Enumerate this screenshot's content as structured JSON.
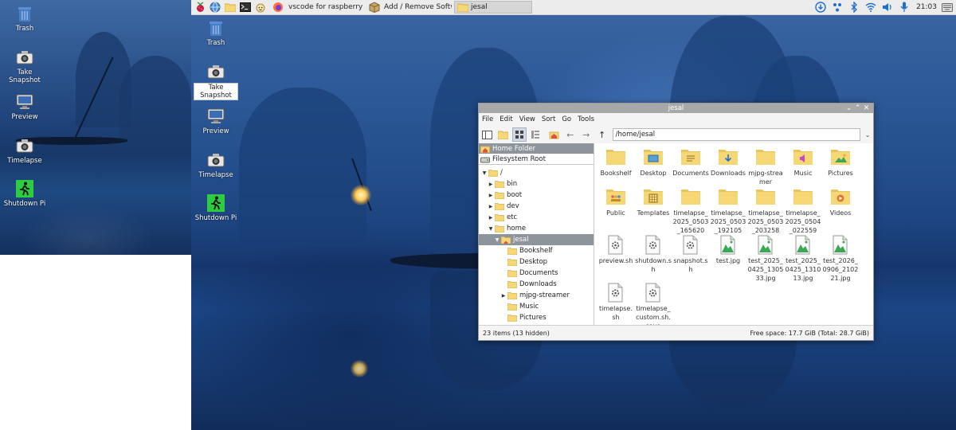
{
  "taskbar": {
    "tasks": [
      {
        "label": "vscode for raspberry ..."
      },
      {
        "label": "Add / Remove Softw..."
      },
      {
        "label": "jesal"
      }
    ],
    "clock": "21:03"
  },
  "left_desktop": {
    "icons": [
      {
        "label": "Trash"
      },
      {
        "label": "Take Snapshot"
      },
      {
        "label": "Preview"
      },
      {
        "label": "Timelapse"
      },
      {
        "label": "Shutdown Pi"
      }
    ]
  },
  "main_desktop": {
    "icons": [
      {
        "label": "Trash"
      },
      {
        "label": "Take Snapshot"
      },
      {
        "label": "Preview"
      },
      {
        "label": "Timelapse"
      },
      {
        "label": "Shutdown Pi"
      }
    ]
  },
  "file_manager": {
    "title": "jesal",
    "menu": [
      "File",
      "Edit",
      "View",
      "Sort",
      "Go",
      "Tools"
    ],
    "path": "/home/jesal",
    "places": [
      "Home Folder",
      "Filesystem Root"
    ],
    "tree": [
      {
        "label": "/"
      },
      {
        "label": "bin"
      },
      {
        "label": "boot"
      },
      {
        "label": "dev"
      },
      {
        "label": "etc"
      },
      {
        "label": "home"
      },
      {
        "label": "jesal"
      },
      {
        "label": "Bookshelf"
      },
      {
        "label": "Desktop"
      },
      {
        "label": "Documents"
      },
      {
        "label": "Downloads"
      },
      {
        "label": "mjpg-streamer"
      },
      {
        "label": "Music"
      },
      {
        "label": "Pictures"
      }
    ],
    "items": [
      {
        "label": "Bookshelf",
        "kind": "folder"
      },
      {
        "label": "Desktop",
        "kind": "folder-desktop"
      },
      {
        "label": "Documents",
        "kind": "folder-documents"
      },
      {
        "label": "Downloads",
        "kind": "folder-downloads"
      },
      {
        "label": "mjpg-streamer",
        "kind": "folder"
      },
      {
        "label": "Music",
        "kind": "folder-music"
      },
      {
        "label": "Pictures",
        "kind": "folder-pictures"
      },
      {
        "label": "Public",
        "kind": "folder-public"
      },
      {
        "label": "Templates",
        "kind": "folder-templates"
      },
      {
        "label": "timelapse_2025_0503_165620",
        "kind": "folder"
      },
      {
        "label": "timelapse_2025_0503_192105",
        "kind": "folder"
      },
      {
        "label": "timelapse_2025_0503_203258",
        "kind": "folder"
      },
      {
        "label": "timelapse_2025_0504_022559",
        "kind": "folder"
      },
      {
        "label": "Videos",
        "kind": "folder-videos"
      },
      {
        "label": "preview.sh",
        "kind": "script"
      },
      {
        "label": "shutdown.sh",
        "kind": "script"
      },
      {
        "label": "snapshot.sh",
        "kind": "script"
      },
      {
        "label": "test.jpg",
        "kind": "image"
      },
      {
        "label": "test_2025_0425_130533.jpg",
        "kind": "image"
      },
      {
        "label": "test_2025_0425_131013.jpg",
        "kind": "image"
      },
      {
        "label": "test_2026_0906_210221.jpg",
        "kind": "image"
      },
      {
        "label": "timelapse.sh",
        "kind": "script"
      },
      {
        "label": "timelapse_custom.sh.save",
        "kind": "script"
      }
    ],
    "status_left": "23 items (13 hidden)",
    "status_right": "Free space: 17.7 GiB (Total: 28.7 GiB)"
  },
  "colors": {
    "folder": "#f6d776",
    "folder_dark": "#e8c45c",
    "desktop_blue": "#2d5a98",
    "selection": "#8e949b",
    "shutdown_green": "#2ecc40"
  }
}
